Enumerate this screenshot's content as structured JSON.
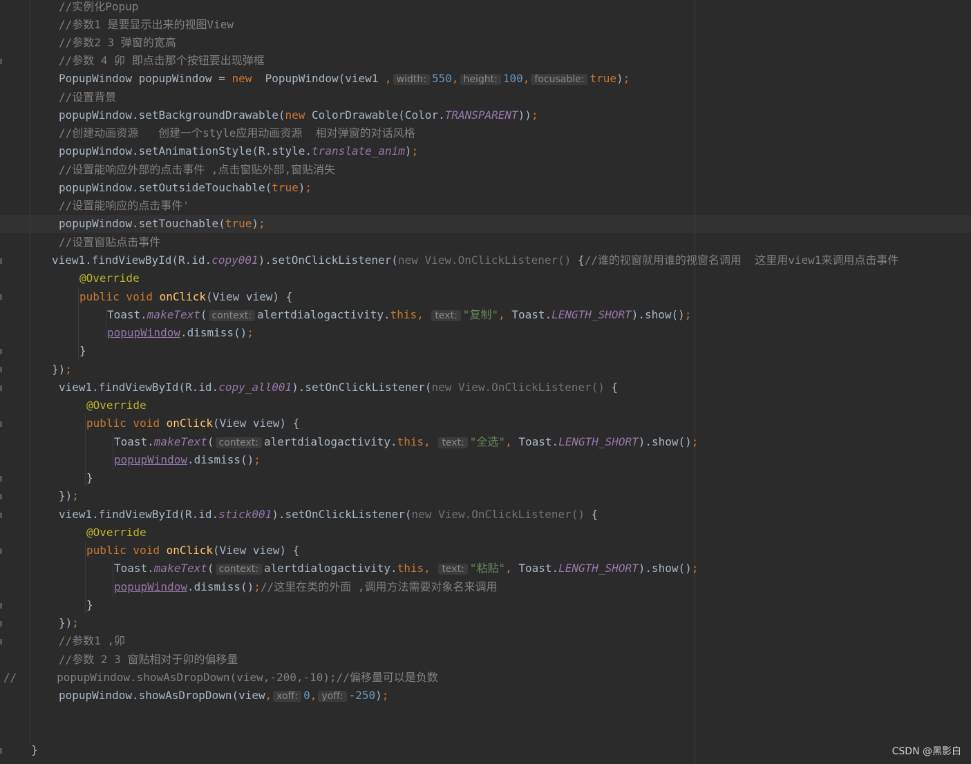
{
  "watermark": "CSDN @黑影白",
  "lines": [
    {
      "parts": [
        {
          "c": "cm",
          "t": "//实例化Popup"
        }
      ]
    },
    {
      "parts": [
        {
          "c": "cm",
          "t": "//参数1 是要显示出来的视图View"
        }
      ]
    },
    {
      "parts": [
        {
          "c": "cm",
          "t": "//参数2 3 弹窗的宽高"
        }
      ]
    },
    {
      "parts": [
        {
          "c": "cm",
          "t": "//参数 4 卯 即点击那个按钮要出现弹框"
        }
      ]
    },
    {
      "parts": [
        {
          "c": "",
          "t": "PopupWindow popupWindow = "
        },
        {
          "c": "kw",
          "t": "new"
        },
        {
          "c": "",
          "t": "  PopupWindow(view1 "
        },
        {
          "c": "kw",
          "t": ","
        },
        {
          "c": "hint",
          "t": "width:"
        },
        {
          "c": "num",
          "t": "550"
        },
        {
          "c": "kw",
          "t": ","
        },
        {
          "c": "hint",
          "t": "height:"
        },
        {
          "c": "num",
          "t": "100"
        },
        {
          "c": "kw",
          "t": ","
        },
        {
          "c": "hint",
          "t": "focusable:"
        },
        {
          "c": "kw",
          "t": "true"
        },
        {
          "c": "",
          "t": ")"
        },
        {
          "c": "kw",
          "t": ";"
        }
      ]
    },
    {
      "parts": [
        {
          "c": "cm",
          "t": "//设置背景"
        }
      ]
    },
    {
      "parts": [
        {
          "c": "",
          "t": "popupWindow.setBackgroundDrawable("
        },
        {
          "c": "kw",
          "t": "new "
        },
        {
          "c": "",
          "t": "ColorDrawable(Color."
        },
        {
          "c": "fld",
          "t": "TRANSPARENT"
        },
        {
          "c": "",
          "t": "))"
        },
        {
          "c": "kw",
          "t": ";"
        }
      ]
    },
    {
      "parts": [
        {
          "c": "cm",
          "t": "//创建动画资源   创建一个style应用动画资源  相对弹窗的对话风格"
        }
      ]
    },
    {
      "parts": [
        {
          "c": "",
          "t": "popupWindow.setAnimationStyle(R.style."
        },
        {
          "c": "fld",
          "t": "translate_anim"
        },
        {
          "c": "",
          "t": ")"
        },
        {
          "c": "kw",
          "t": ";"
        }
      ]
    },
    {
      "parts": [
        {
          "c": "cm",
          "t": "//设置能响应外部的点击事件 ,点击窗贴外部,窗贴消失"
        }
      ]
    },
    {
      "parts": [
        {
          "c": "",
          "t": "popupWindow.setOutsideTouchable("
        },
        {
          "c": "kw",
          "t": "true"
        },
        {
          "c": "",
          "t": ")"
        },
        {
          "c": "kw",
          "t": ";"
        }
      ]
    },
    {
      "parts": [
        {
          "c": "cm",
          "t": "//设置能响应的点击事件'"
        }
      ]
    },
    {
      "parts": [
        {
          "c": "",
          "t": "popupWindow.setTouchable("
        },
        {
          "c": "kw",
          "t": "true"
        },
        {
          "c": "",
          "t": ")"
        },
        {
          "c": "kw",
          "t": ";"
        }
      ]
    },
    {
      "parts": [
        {
          "c": "cm",
          "t": "//设置窗贴点击事件"
        }
      ]
    },
    {
      "parts": [
        {
          "c": "",
          "t": "view1.findViewById(R.id."
        },
        {
          "c": "fld",
          "t": "copy001"
        },
        {
          "c": "",
          "t": ").setOnClickListener("
        },
        {
          "c": "dim",
          "t": "new View.OnClickListener() "
        },
        {
          "c": "",
          "t": "{"
        },
        {
          "c": "cm",
          "t": "//谁的视窗就用谁的视窗名调用  这里用view1来调用点击事件"
        }
      ]
    },
    {
      "parts": [
        {
          "c": "ann",
          "t": "@Override"
        }
      ]
    },
    {
      "parts": [
        {
          "c": "kw",
          "t": "public void "
        },
        {
          "c": "fn",
          "t": "onClick"
        },
        {
          "c": "",
          "t": "(View view) {"
        }
      ]
    },
    {
      "parts": [
        {
          "c": "",
          "t": "Toast."
        },
        {
          "c": "fldi",
          "t": "makeText"
        },
        {
          "c": "",
          "t": "("
        },
        {
          "c": "hint",
          "t": "context:"
        },
        {
          "c": "",
          "t": "alertdialogactivity."
        },
        {
          "c": "kw",
          "t": "this, "
        },
        {
          "c": "hint",
          "t": "text:"
        },
        {
          "c": "str",
          "t": "\"复制\""
        },
        {
          "c": "kw",
          "t": ", "
        },
        {
          "c": "",
          "t": "Toast."
        },
        {
          "c": "fld",
          "t": "LENGTH_SHORT"
        },
        {
          "c": "",
          "t": ").show()"
        },
        {
          "c": "kw",
          "t": ";"
        }
      ]
    },
    {
      "parts": [
        {
          "c": "u",
          "t": "popupWindow"
        },
        {
          "c": "",
          "t": ".dismiss()"
        },
        {
          "c": "kw",
          "t": ";"
        }
      ]
    },
    {
      "parts": [
        {
          "c": "",
          "t": "}"
        }
      ]
    },
    {
      "parts": [
        {
          "c": "",
          "t": "})"
        },
        {
          "c": "kw",
          "t": ";"
        }
      ]
    },
    {
      "parts": [
        {
          "c": "",
          "t": "view1.findViewById(R.id."
        },
        {
          "c": "fld",
          "t": "copy_all001"
        },
        {
          "c": "",
          "t": ").setOnClickListener("
        },
        {
          "c": "dim",
          "t": "new View.OnClickListener() "
        },
        {
          "c": "",
          "t": "{"
        }
      ]
    },
    {
      "parts": [
        {
          "c": "ann",
          "t": "@Override"
        }
      ]
    },
    {
      "parts": [
        {
          "c": "kw",
          "t": "public void "
        },
        {
          "c": "fn",
          "t": "onClick"
        },
        {
          "c": "",
          "t": "(View view) {"
        }
      ]
    },
    {
      "parts": [
        {
          "c": "",
          "t": "Toast."
        },
        {
          "c": "fldi",
          "t": "makeText"
        },
        {
          "c": "",
          "t": "("
        },
        {
          "c": "hint",
          "t": "context:"
        },
        {
          "c": "",
          "t": "alertdialogactivity."
        },
        {
          "c": "kw",
          "t": "this, "
        },
        {
          "c": "hint",
          "t": "text:"
        },
        {
          "c": "str",
          "t": "\"全选\""
        },
        {
          "c": "kw",
          "t": ", "
        },
        {
          "c": "",
          "t": "Toast."
        },
        {
          "c": "fld",
          "t": "LENGTH_SHORT"
        },
        {
          "c": "",
          "t": ").show()"
        },
        {
          "c": "kw",
          "t": ";"
        }
      ]
    },
    {
      "parts": [
        {
          "c": "u",
          "t": "popupWindow"
        },
        {
          "c": "",
          "t": ".dismiss()"
        },
        {
          "c": "kw",
          "t": ";"
        }
      ]
    },
    {
      "parts": [
        {
          "c": "",
          "t": "}"
        }
      ]
    },
    {
      "parts": [
        {
          "c": "",
          "t": "})"
        },
        {
          "c": "kw",
          "t": ";"
        }
      ]
    },
    {
      "parts": [
        {
          "c": "",
          "t": "view1.findViewById(R.id."
        },
        {
          "c": "fld",
          "t": "stick001"
        },
        {
          "c": "",
          "t": ").setOnClickListener("
        },
        {
          "c": "dim",
          "t": "new View.OnClickListener() "
        },
        {
          "c": "",
          "t": "{"
        }
      ]
    },
    {
      "parts": [
        {
          "c": "ann",
          "t": "@Override"
        }
      ]
    },
    {
      "parts": [
        {
          "c": "kw",
          "t": "public void "
        },
        {
          "c": "fn",
          "t": "onClick"
        },
        {
          "c": "",
          "t": "(View view) {"
        }
      ]
    },
    {
      "parts": [
        {
          "c": "",
          "t": "Toast."
        },
        {
          "c": "fldi",
          "t": "makeText"
        },
        {
          "c": "",
          "t": "("
        },
        {
          "c": "hint",
          "t": "context:"
        },
        {
          "c": "",
          "t": "alertdialogactivity."
        },
        {
          "c": "kw",
          "t": "this, "
        },
        {
          "c": "hint",
          "t": "text:"
        },
        {
          "c": "str",
          "t": "\"粘贴\""
        },
        {
          "c": "kw",
          "t": ", "
        },
        {
          "c": "",
          "t": "Toast."
        },
        {
          "c": "fld",
          "t": "LENGTH_SHORT"
        },
        {
          "c": "",
          "t": ").show()"
        },
        {
          "c": "kw",
          "t": ";"
        }
      ]
    },
    {
      "parts": [
        {
          "c": "u",
          "t": "popupWindow"
        },
        {
          "c": "",
          "t": ".dismiss()"
        },
        {
          "c": "kw",
          "t": ";"
        },
        {
          "c": "cm",
          "t": "//这里在类的外面 ,调用方法需要对象名来调用"
        }
      ]
    },
    {
      "parts": [
        {
          "c": "",
          "t": "}"
        }
      ]
    },
    {
      "parts": [
        {
          "c": "",
          "t": "})"
        },
        {
          "c": "kw",
          "t": ";"
        }
      ]
    },
    {
      "parts": [
        {
          "c": "cm",
          "t": "//参数1 ,卯"
        }
      ]
    },
    {
      "parts": [
        {
          "c": "cm",
          "t": "//参数 2 3 窗贴相对于卯的偏移量"
        }
      ]
    },
    {
      "parts": [
        {
          "c": "cm",
          "t": "//      popupWindow.showAsDropDown(view,-200,-10);//偏移量可以是负数"
        }
      ]
    },
    {
      "parts": [
        {
          "c": "",
          "t": "popupWindow.showAsDropDown(view"
        },
        {
          "c": "kw",
          "t": ","
        },
        {
          "c": "hint",
          "t": "xoff:"
        },
        {
          "c": "num",
          "t": "0"
        },
        {
          "c": "kw",
          "t": ","
        },
        {
          "c": "hint",
          "t": "yoff:"
        },
        {
          "c": "",
          "t": "-"
        },
        {
          "c": "num",
          "t": "250"
        },
        {
          "c": "",
          "t": ")"
        },
        {
          "c": "kw",
          "t": ";"
        }
      ]
    },
    {
      "parts": [
        {
          "c": "",
          "t": "}"
        }
      ]
    }
  ]
}
